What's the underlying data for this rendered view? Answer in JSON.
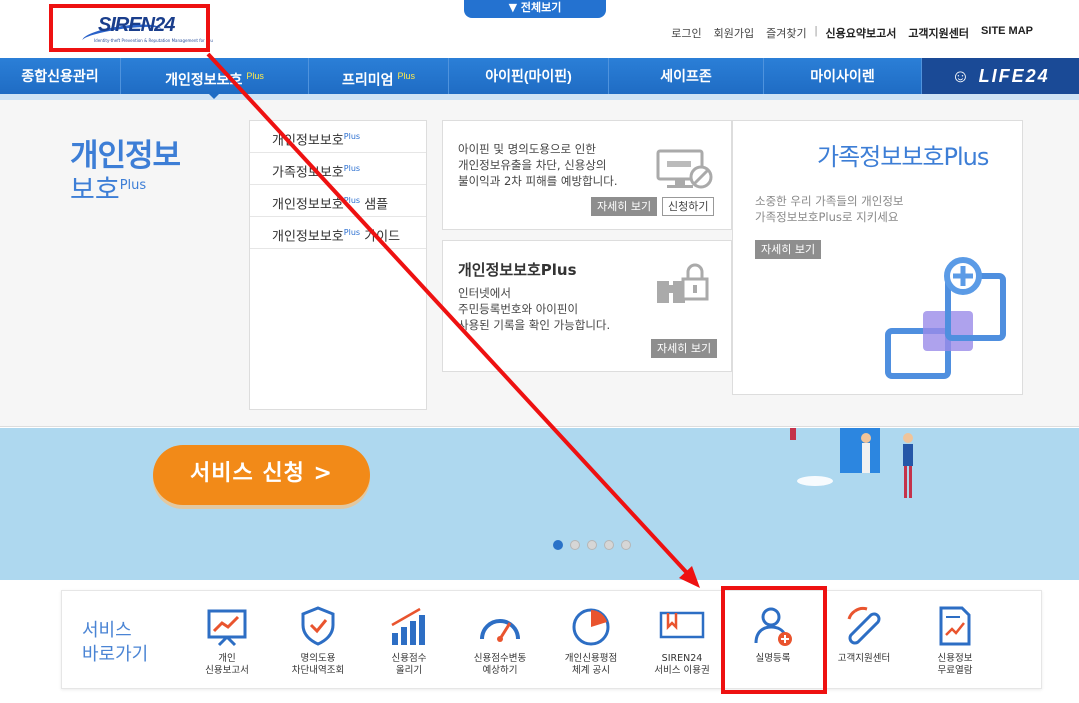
{
  "header": {
    "logo_text": "SIREN24",
    "logo_sub": "Identity-theft Prevention & Reputation Management for You",
    "all_view": "▼ 전체보기",
    "util_links": [
      "로그인",
      "회원가입",
      "즐겨찾기",
      "신용요약보고서",
      "고객지원센터",
      "SITE MAP"
    ]
  },
  "nav": {
    "items": [
      {
        "label": "종합신용관리",
        "sup": ""
      },
      {
        "label": "개인정보보호",
        "sup": "Plus"
      },
      {
        "label": "프리미엄",
        "sup": "Plus"
      },
      {
        "label": "아이핀(마이핀)",
        "sup": ""
      },
      {
        "label": "세이프존",
        "sup": ""
      },
      {
        "label": "마이사이렌",
        "sup": ""
      }
    ],
    "life_label": "LIFE24"
  },
  "panel": {
    "title_line1": "개인정보",
    "title_line2": "보호",
    "title_sup": "Plus",
    "submenu": [
      {
        "label": "개인정보보호",
        "sup": "Plus",
        "suffix": ""
      },
      {
        "label": "가족정보보호",
        "sup": "Plus",
        "suffix": ""
      },
      {
        "label": "개인정보보호",
        "sup": "Plus",
        "suffix": " 샘플"
      },
      {
        "label": "개인정보보호",
        "sup": "Plus",
        "suffix": " 가이드"
      }
    ],
    "card1": {
      "text": "아이핀 및 명의도용으로 인한\n개인정보유출을 차단, 신용상의\n불이익과 2차 피해를 예방합니다.",
      "detail_btn": "자세히 보기",
      "apply_btn": "신청하기"
    },
    "card2": {
      "title": "개인정보보호Plus",
      "text": "인터넷에서\n주민등록번호와 아이핀이\n사용된 기록을 확인 가능합니다.",
      "detail_btn": "자세히 보기"
    },
    "card3": {
      "title": "가족정보보호Plus",
      "text": "소중한 우리 가족들의 개인정보\n가족정보보호Plus로 지키세요",
      "detail_btn": "자세히 보기"
    }
  },
  "banner": {
    "service_button": "서비스 신청  >",
    "dots": 5,
    "active_dot": 0
  },
  "quick": {
    "title": "서비스\n바로가기",
    "items": [
      {
        "label": "개인\n신용보고서",
        "icon": "chart-board-icon"
      },
      {
        "label": "명의도용\n차단내역조회",
        "icon": "shield-check-icon"
      },
      {
        "label": "신용점수\n올리기",
        "icon": "bar-growth-icon"
      },
      {
        "label": "신용점수변동\n예상하기",
        "icon": "gauge-icon"
      },
      {
        "label": "개인신용평점\n체계 공시",
        "icon": "pie-chart-icon"
      },
      {
        "label": "SIREN24\n서비스 이용권",
        "icon": "ticket-icon"
      },
      {
        "label": "실명등록",
        "icon": "user-add-icon"
      },
      {
        "label": "고객지원센터",
        "icon": "phone-icon"
      },
      {
        "label": "신용정보\n무료열람",
        "icon": "document-chart-icon"
      }
    ]
  },
  "colors": {
    "accent": "#2472d0",
    "nav_bg": "#1f6cc4",
    "orange": "#f28a18",
    "annotation": "#ee1111"
  }
}
